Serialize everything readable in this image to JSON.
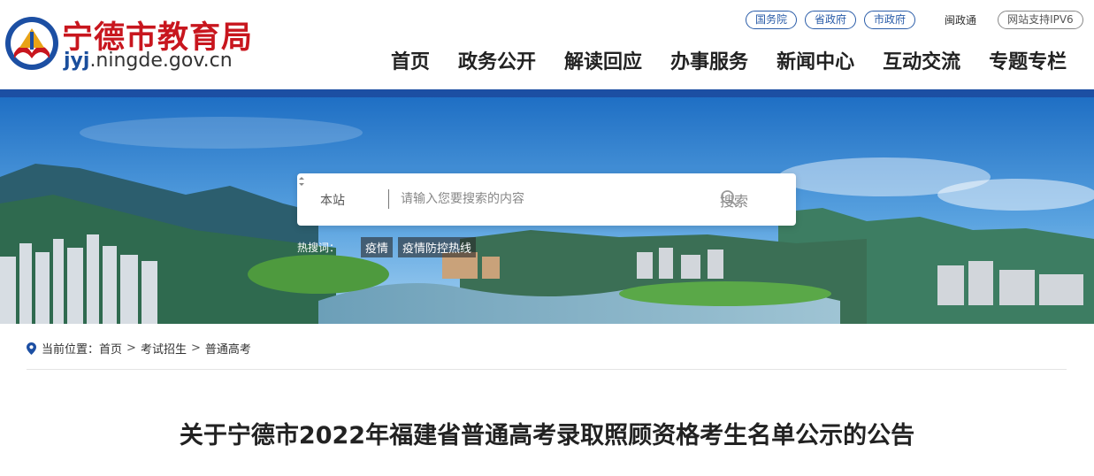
{
  "site": {
    "name_cn": "宁德市教育局",
    "domain_prefix": "jyj",
    "domain_rest": ".ningde.gov.cn"
  },
  "top_links": {
    "state_council": "国务院",
    "provincial_gov": "省政府",
    "city_gov": "市政府",
    "min_zheng_tong": "闽政通",
    "ipv6": "网站支持IPV6"
  },
  "nav": {
    "items": [
      "首页",
      "政务公开",
      "解读回应",
      "办事服务",
      "新闻中心",
      "互动交流",
      "专题专栏"
    ]
  },
  "search": {
    "scope": "本站",
    "placeholder": "请输入您要搜索的内容",
    "button": "搜索",
    "hot_label": "热搜词：",
    "hot_words": [
      "疫情",
      "疫情防控热线"
    ]
  },
  "breadcrumb": {
    "prefix": "当前位置：",
    "items": [
      "首页",
      "考试招生",
      "普通高考"
    ],
    "separator": ">"
  },
  "article": {
    "title": "关于宁德市2022年福建省普通高考录取照顾资格考生名单公示的公告"
  },
  "colors": {
    "brand_red": "#c8161e",
    "brand_blue": "#1c4fa3",
    "pill_blue": "#2a5ca8"
  }
}
